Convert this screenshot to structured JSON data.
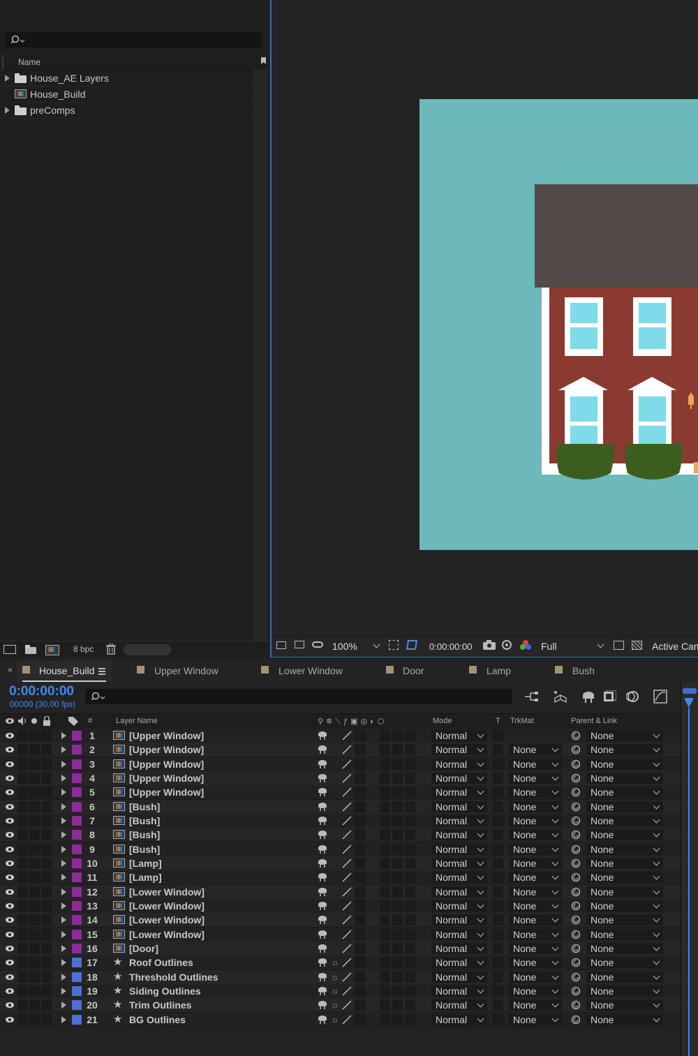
{
  "project": {
    "columns": {
      "name": "Name"
    },
    "items": [
      {
        "label": "House_AE Layers",
        "kind": "folder"
      },
      {
        "label": "House_Build",
        "kind": "composition"
      },
      {
        "label": "preComps",
        "kind": "folder"
      }
    ],
    "bpc": "8 bpc"
  },
  "viewer": {
    "zoom": "100%",
    "timecode": "0:00:00:00",
    "resolution": "Full",
    "camera": "Active Cam",
    "colors": {
      "background": "#6db9b9",
      "roof": "#534a4a",
      "walls": "#8b3a32",
      "trim": "#ffffff",
      "glass": "#80dbe9",
      "bush": "#3b5e1f",
      "lamp": "#e8a657"
    }
  },
  "timeline": {
    "tabs": [
      {
        "label": "House_Build",
        "active": true,
        "color": "#a39274"
      },
      {
        "label": "Upper Window",
        "color": "#a39274"
      },
      {
        "label": "Lower Window",
        "color": "#a39274"
      },
      {
        "label": "Door",
        "color": "#a39274"
      },
      {
        "label": "Lamp",
        "color": "#a39274"
      },
      {
        "label": "Bush",
        "color": "#a39274"
      }
    ],
    "current_time": "0:00:00:00",
    "frame_info": "00000 (30.00 fps)",
    "columns": {
      "number": "#",
      "layer_name": "Layer Name",
      "mode": "Mode",
      "t": "T",
      "trkmat": "TrkMat",
      "parent": "Parent & Link"
    },
    "layers": [
      {
        "num": "1",
        "name": "[Upper Window]",
        "type": "comp",
        "label_color": "#8e2a9a",
        "mode": "Normal",
        "trkmat": "",
        "parent": "None"
      },
      {
        "num": "2",
        "name": "[Upper Window]",
        "type": "comp",
        "label_color": "#8e2a9a",
        "mode": "Normal",
        "trkmat": "None",
        "parent": "None"
      },
      {
        "num": "3",
        "name": "[Upper Window]",
        "type": "comp",
        "label_color": "#8e2a9a",
        "mode": "Normal",
        "trkmat": "None",
        "parent": "None"
      },
      {
        "num": "4",
        "name": "[Upper Window]",
        "type": "comp",
        "label_color": "#8e2a9a",
        "mode": "Normal",
        "trkmat": "None",
        "parent": "None"
      },
      {
        "num": "5",
        "name": "[Upper Window]",
        "type": "comp",
        "label_color": "#8e2a9a",
        "mode": "Normal",
        "trkmat": "None",
        "parent": "None"
      },
      {
        "num": "6",
        "name": "[Bush]",
        "type": "comp",
        "label_color": "#8e2a9a",
        "mode": "Normal",
        "trkmat": "None",
        "parent": "None"
      },
      {
        "num": "7",
        "name": "[Bush]",
        "type": "comp",
        "label_color": "#8e2a9a",
        "mode": "Normal",
        "trkmat": "None",
        "parent": "None"
      },
      {
        "num": "8",
        "name": "[Bush]",
        "type": "comp",
        "label_color": "#8e2a9a",
        "mode": "Normal",
        "trkmat": "None",
        "parent": "None"
      },
      {
        "num": "9",
        "name": "[Bush]",
        "type": "comp",
        "label_color": "#8e2a9a",
        "mode": "Normal",
        "trkmat": "None",
        "parent": "None"
      },
      {
        "num": "10",
        "name": "[Lamp]",
        "type": "comp",
        "label_color": "#8e2a9a",
        "mode": "Normal",
        "trkmat": "None",
        "parent": "None"
      },
      {
        "num": "11",
        "name": "[Lamp]",
        "type": "comp",
        "label_color": "#8e2a9a",
        "mode": "Normal",
        "trkmat": "None",
        "parent": "None"
      },
      {
        "num": "12",
        "name": "[Lower Window]",
        "type": "comp",
        "label_color": "#8e2a9a",
        "mode": "Normal",
        "trkmat": "None",
        "parent": "None"
      },
      {
        "num": "13",
        "name": "[Lower Window]",
        "type": "comp",
        "label_color": "#8e2a9a",
        "mode": "Normal",
        "trkmat": "None",
        "parent": "None"
      },
      {
        "num": "14",
        "name": "[Lower Window]",
        "type": "comp",
        "label_color": "#8e2a9a",
        "mode": "Normal",
        "trkmat": "None",
        "parent": "None"
      },
      {
        "num": "15",
        "name": "[Lower Window]",
        "type": "comp",
        "label_color": "#8e2a9a",
        "mode": "Normal",
        "trkmat": "None",
        "parent": "None"
      },
      {
        "num": "16",
        "name": "[Door]",
        "type": "comp",
        "label_color": "#8e2a9a",
        "mode": "Normal",
        "trkmat": "None",
        "parent": "None"
      },
      {
        "num": "17",
        "name": "Roof Outlines",
        "type": "shape",
        "label_color": "#4f6fd6",
        "mode": "Normal",
        "trkmat": "None",
        "parent": "None"
      },
      {
        "num": "18",
        "name": "Threshold Outlines",
        "type": "shape",
        "label_color": "#4f6fd6",
        "mode": "Normal",
        "trkmat": "None",
        "parent": "None"
      },
      {
        "num": "19",
        "name": "Siding Outlines",
        "type": "shape",
        "label_color": "#4f6fd6",
        "mode": "Normal",
        "trkmat": "None",
        "parent": "None"
      },
      {
        "num": "20",
        "name": "Trim Outlines",
        "type": "shape",
        "label_color": "#4f6fd6",
        "mode": "Normal",
        "trkmat": "None",
        "parent": "None"
      },
      {
        "num": "21",
        "name": "BG Outlines",
        "type": "shape",
        "label_color": "#4f6fd6",
        "mode": "Normal",
        "trkmat": "None",
        "parent": "None"
      }
    ]
  }
}
